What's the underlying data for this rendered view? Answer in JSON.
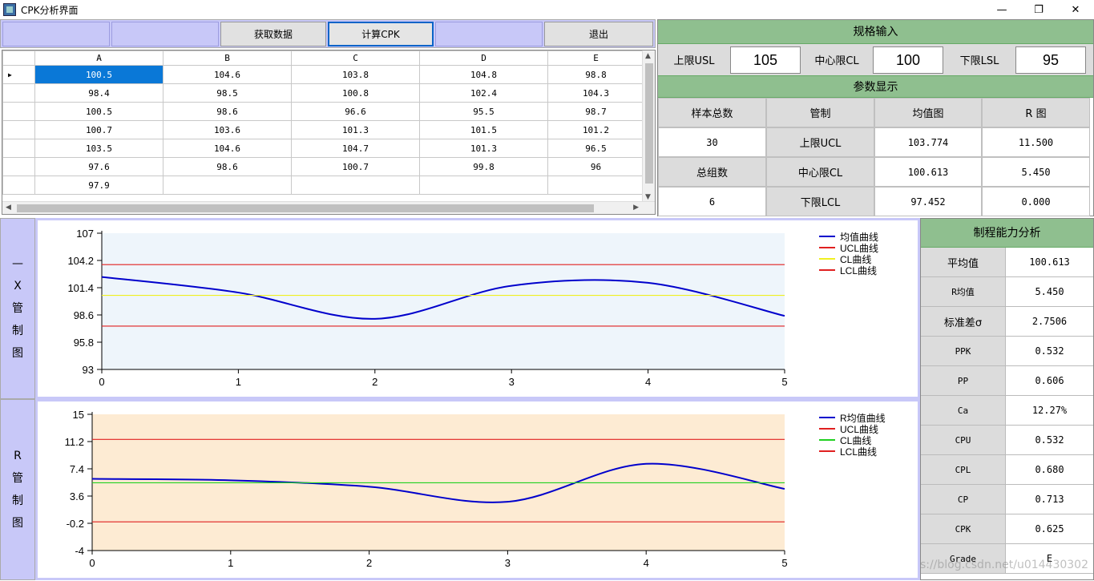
{
  "window": {
    "title": "CPK分析界面",
    "min": "—",
    "max": "❐",
    "close": "✕"
  },
  "toolbar": {
    "get_data": "获取数据",
    "calc": "计算CPK",
    "exit": "退出"
  },
  "grid": {
    "columns": [
      "A",
      "B",
      "C",
      "D",
      "E"
    ],
    "rows": [
      [
        "100.5",
        "104.6",
        "103.8",
        "104.8",
        "98.8"
      ],
      [
        "98.4",
        "98.5",
        "100.8",
        "102.4",
        "104.3"
      ],
      [
        "100.5",
        "98.6",
        "96.6",
        "95.5",
        "98.7"
      ],
      [
        "100.7",
        "103.6",
        "101.3",
        "101.5",
        "101.2"
      ],
      [
        "103.5",
        "104.6",
        "104.7",
        "101.3",
        "96.5"
      ],
      [
        "97.6",
        "98.6",
        "100.7",
        "99.8",
        "96"
      ],
      [
        "97.9",
        "",
        "",
        "",
        ""
      ]
    ]
  },
  "spec": {
    "title": "规格输入",
    "usl_label": "上限USL",
    "usl": "105",
    "cl_label": "中心限CL",
    "cl": "100",
    "lsl_label": "下限LSL",
    "lsl": "95"
  },
  "params": {
    "title": "参数显示",
    "h1": "样本总数",
    "h2": "管制",
    "h3": "均值图",
    "h4": "R 图",
    "total": "30",
    "ucl_label": "上限UCL",
    "ucl_x": "103.774",
    "ucl_r": "11.500",
    "groups_label": "总组数",
    "cl_label": "中心限CL",
    "cl_x": "100.613",
    "cl_r": "5.450",
    "groups": "6",
    "lcl_label": "下限LCL",
    "lcl_x": "97.452",
    "lcl_r": "0.000"
  },
  "side_x": {
    "c1": "—",
    "c2": "X",
    "c3": "管",
    "c4": "制",
    "c5": "图"
  },
  "side_r": {
    "c1": "R",
    "c2": "管",
    "c3": "制",
    "c4": "图"
  },
  "capability": {
    "title": "制程能力分析",
    "rows": [
      {
        "k": "平均值",
        "v": "100.613"
      },
      {
        "k": "R均值",
        "v": "5.450"
      },
      {
        "k": "标准差σ",
        "v": "2.7506"
      },
      {
        "k": "PPK",
        "v": "0.532"
      },
      {
        "k": "PP",
        "v": "0.606"
      },
      {
        "k": "Ca",
        "v": "12.27%"
      },
      {
        "k": "CPU",
        "v": "0.532"
      },
      {
        "k": "CPL",
        "v": "0.680"
      },
      {
        "k": "CP",
        "v": "0.713"
      },
      {
        "k": "CPK",
        "v": "0.625"
      },
      {
        "k": "Grade",
        "v": "E"
      }
    ]
  },
  "watermark": "https://blog.csdn.net/u014430302",
  "chart_data": [
    {
      "type": "line",
      "x": [
        0,
        1,
        2,
        3,
        4,
        5
      ],
      "ylim": [
        93,
        107
      ],
      "yticks": [
        "107",
        "104.2",
        "101.4",
        "98.6",
        "95.8",
        "93"
      ],
      "xticks": [
        "0",
        "1",
        "2",
        "3",
        "4",
        "5"
      ],
      "legend_position": "top-right",
      "background": "#eef5fb",
      "series": [
        {
          "name": "均值曲线",
          "color": "#0000cc",
          "smooth": true,
          "values": [
            102.5,
            100.9,
            98.2,
            101.6,
            101.9,
            98.5
          ]
        },
        {
          "name": "UCL曲线",
          "color": "#e02020",
          "values": [
            103.774,
            103.774,
            103.774,
            103.774,
            103.774,
            103.774
          ]
        },
        {
          "name": "CL曲线",
          "color": "#f0f020",
          "values": [
            100.613,
            100.613,
            100.613,
            100.613,
            100.613,
            100.613
          ]
        },
        {
          "name": "LCL曲线",
          "color": "#e02020",
          "values": [
            97.452,
            97.452,
            97.452,
            97.452,
            97.452,
            97.452
          ]
        }
      ]
    },
    {
      "type": "line",
      "x": [
        0,
        1,
        2,
        3,
        4,
        5
      ],
      "ylim": [
        -4,
        15
      ],
      "yticks": [
        "15",
        "11.2",
        "7.4",
        "3.6",
        "-0.2",
        "-4"
      ],
      "xticks": [
        "0",
        "1",
        "2",
        "3",
        "4",
        "5"
      ],
      "legend_position": "top-right",
      "background": "#fdebd3",
      "series": [
        {
          "name": "R均值曲线",
          "color": "#0000cc",
          "smooth": true,
          "values": [
            6.0,
            5.8,
            4.9,
            2.8,
            8.1,
            4.6
          ]
        },
        {
          "name": "UCL曲线",
          "color": "#e02020",
          "values": [
            11.5,
            11.5,
            11.5,
            11.5,
            11.5,
            11.5
          ]
        },
        {
          "name": "CL曲线",
          "color": "#20d020",
          "values": [
            5.45,
            5.45,
            5.45,
            5.45,
            5.45,
            5.45
          ]
        },
        {
          "name": "LCL曲线",
          "color": "#e02020",
          "values": [
            0,
            0,
            0,
            0,
            0,
            0
          ]
        }
      ]
    }
  ]
}
